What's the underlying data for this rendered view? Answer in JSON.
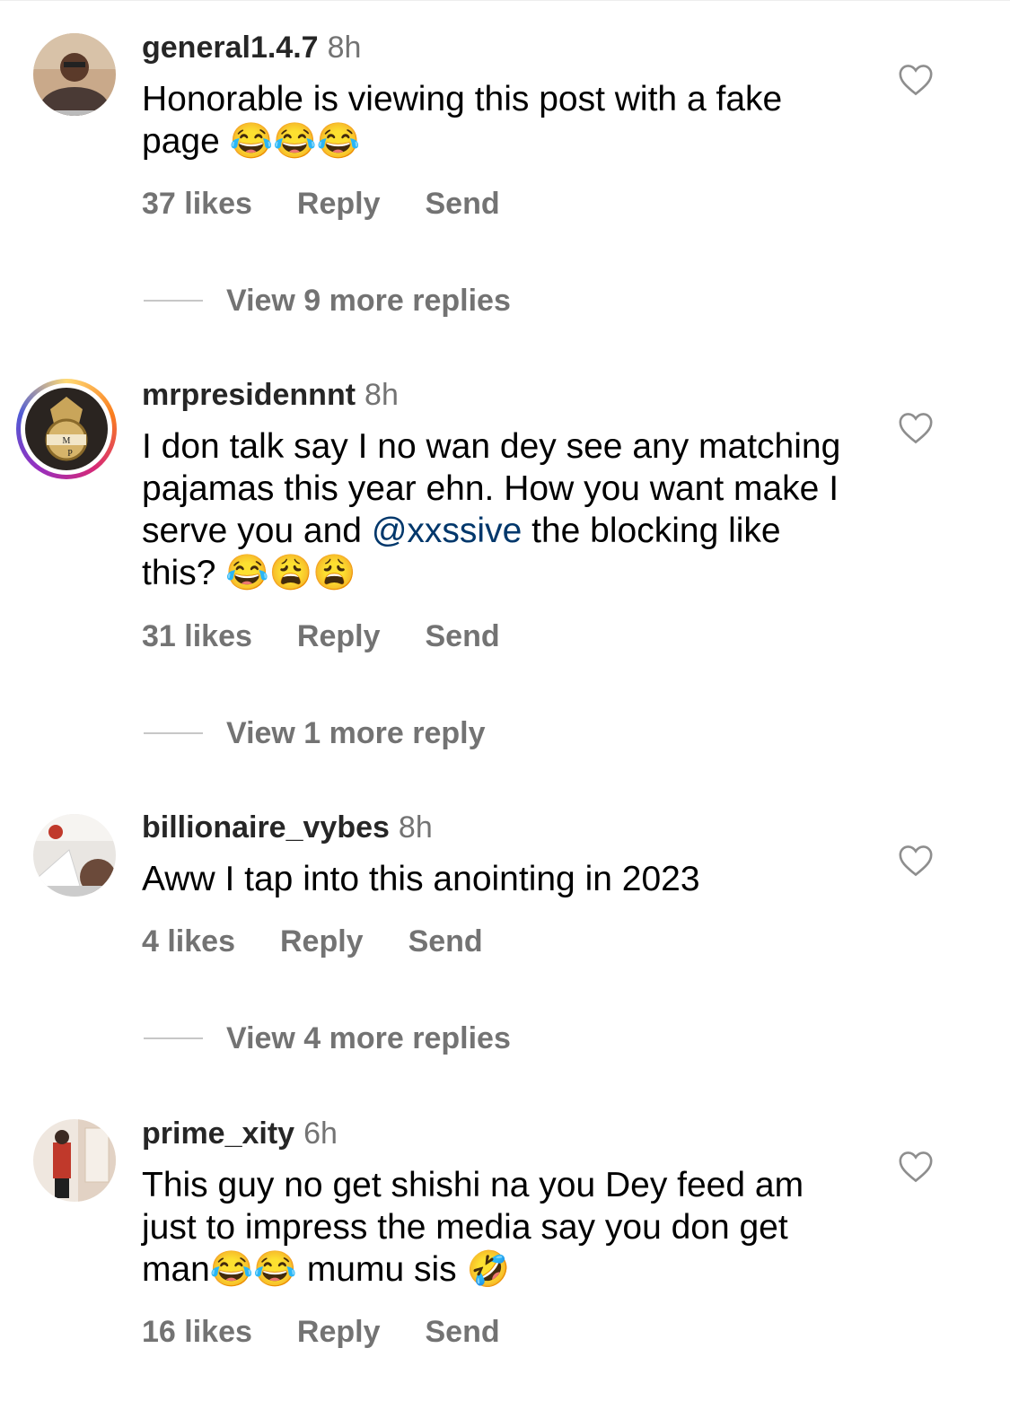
{
  "comments": [
    {
      "username": "general1.4.7",
      "time": "8h",
      "text": "Honorable is viewing this post with a fake page 😂😂😂",
      "likes": "37 likes",
      "reply": "Reply",
      "send": "Send",
      "view_replies": "View 9 more replies"
    },
    {
      "username": "mrpresidennnt",
      "time": "8h",
      "text_before": "I don talk say I no wan dey see any matching pajamas this year ehn. How you want make I serve you and ",
      "mention": "@xxssive",
      "text_after": " the blocking like this? 😂😩😩",
      "likes": "31 likes",
      "reply": "Reply",
      "send": "Send",
      "view_replies": "View 1 more reply"
    },
    {
      "username": "billionaire_vybes",
      "time": "8h",
      "text": "Aww I tap into this anointing in 2023",
      "likes": "4 likes",
      "reply": "Reply",
      "send": "Send",
      "view_replies": "View 4 more replies"
    },
    {
      "username": "prime_xity",
      "time": "6h",
      "text": "This guy no get shishi na you Dey feed am just to impress the media say you don get man😂😂 mumu sis 🤣",
      "likes": "16 likes",
      "reply": "Reply",
      "send": "Send"
    }
  ]
}
